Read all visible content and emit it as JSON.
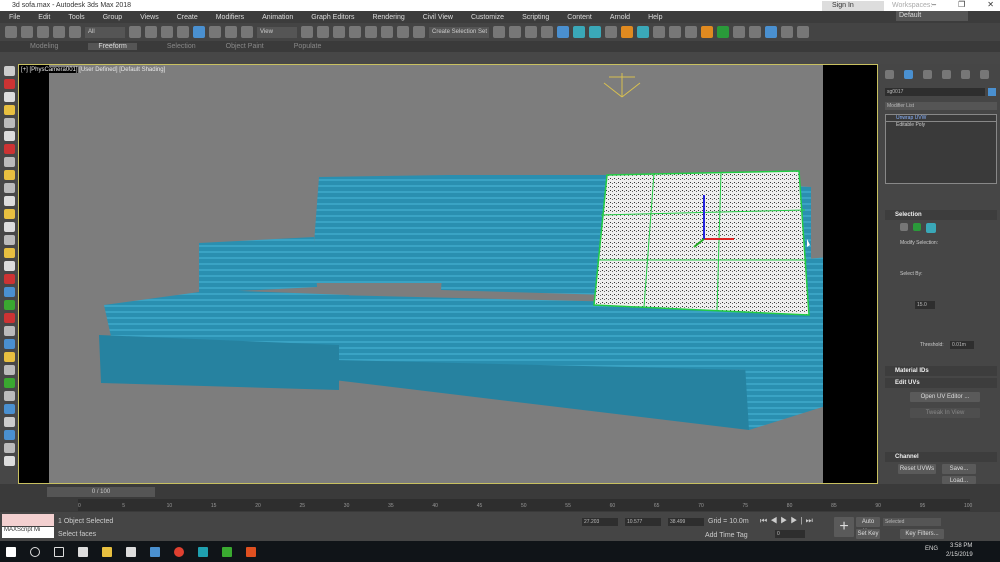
{
  "window": {
    "title": "3d sofa.max - Autodesk 3ds Max 2018",
    "controls": [
      "–",
      "❐",
      "✕"
    ]
  },
  "menu": [
    "File",
    "Edit",
    "Tools",
    "Group",
    "Views",
    "Create",
    "Modifiers",
    "Animation",
    "Graph Editors",
    "Rendering",
    "Civil View",
    "Customize",
    "Scripting",
    "Content",
    "Arnold",
    "Help"
  ],
  "account": {
    "sign_in": "Sign In",
    "workspaces_label": "Workspaces:",
    "workspace": "Default"
  },
  "toolbar": {
    "filter": "All",
    "ref_coord": "View",
    "selection_set": "Create Selection Set"
  },
  "ribbon": {
    "tabs": [
      "Modeling",
      "Freeform",
      "Selection",
      "Object Paint",
      "Populate"
    ],
    "active": "Freeform"
  },
  "viewport": {
    "label_camera": "[+] [PhysCamera001]",
    "label_rest": "[User Defined] [Default Shading]"
  },
  "command_panel": {
    "object_name": "sg0017",
    "modifier_list": "Modifier List",
    "stack": [
      "Unwrap UVW",
      "Editable Poly"
    ],
    "selection": {
      "title": "Selection",
      "modify_selection": "Modify Selection:",
      "select_by": "Select By:",
      "angle": "15.0",
      "threshold_label": "Threshold:",
      "threshold": "0.01m"
    },
    "material_ids": "Material IDs",
    "edit_uvs": {
      "title": "Edit UVs",
      "open_editor": "Open UV Editor ...",
      "tweak": "Tweak In View"
    },
    "channel": {
      "title": "Channel",
      "reset": "Reset UVWs",
      "save": "Save...",
      "load": "Load..."
    }
  },
  "timeline": {
    "frame": "0 / 100",
    "ticks": [
      "0",
      "5",
      "10",
      "15",
      "20",
      "25",
      "30",
      "35",
      "40",
      "45",
      "50",
      "55",
      "60",
      "65",
      "70",
      "75",
      "80",
      "85",
      "90",
      "95",
      "100"
    ]
  },
  "status": {
    "selected": "1 Object Selected",
    "prompt": "Select faces",
    "maxscript": "MAXScript Mi",
    "x": "27.203",
    "y": "10.577",
    "z": "38.499",
    "grid": "Grid = 10.0m",
    "add_time_tag": "Add Time Tag",
    "auto_key": "Auto Key",
    "set_key": "Set Key",
    "key_mode": "Selected",
    "key_filters": "Key Filters...",
    "frame_field": "0"
  },
  "taskbar": {
    "time": "3:58 PM",
    "date": "2/15/2019",
    "lang": "ENG"
  },
  "colors": {
    "sofa": "#2a8fb0",
    "selection": "#22cc44",
    "viewport_bg": "#7d7d7d",
    "accent": "#4a90d0"
  }
}
